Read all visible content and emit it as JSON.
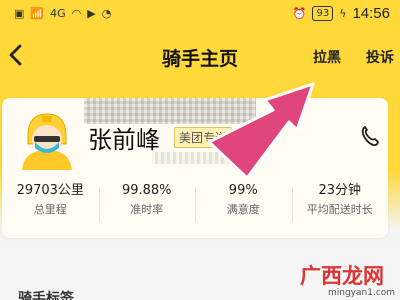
{
  "status_bar": {
    "signal_text": "4G",
    "battery": "93",
    "time": "14:56"
  },
  "nav": {
    "title": "骑手主页",
    "blacklist_label": "拉黑",
    "report_label": "投诉"
  },
  "rider": {
    "name": "张前峰",
    "tag": "美团专送"
  },
  "stats": [
    {
      "value": "29703公里",
      "label": "总里程"
    },
    {
      "value": "99.88%",
      "label": "准时率"
    },
    {
      "value": "99%",
      "label": "满意度"
    },
    {
      "value": "23分钟",
      "label": "平均配送时长"
    }
  ],
  "section": {
    "title_partial": "骑手标签"
  },
  "watermark": {
    "text": "广西龙网",
    "url": "mingyan1.com"
  },
  "colors": {
    "brand_yellow": "#ffd93a",
    "arrow_pink": "#e0457b",
    "watermark_red": "#dd3333"
  }
}
